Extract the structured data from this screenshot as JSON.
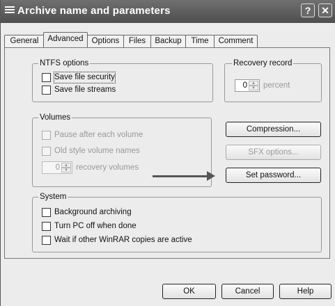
{
  "window": {
    "title": "Archive name and parameters",
    "help_button": "?",
    "close_button": "✕"
  },
  "tabs": [
    {
      "label": "General",
      "active": false
    },
    {
      "label": "Advanced",
      "active": true
    },
    {
      "label": "Options",
      "active": false
    },
    {
      "label": "Files",
      "active": false
    },
    {
      "label": "Backup",
      "active": false
    },
    {
      "label": "Time",
      "active": false
    },
    {
      "label": "Comment",
      "active": false
    }
  ],
  "ntfs": {
    "label": "NTFS options",
    "save_security": {
      "label": "Save file security",
      "checked": false
    },
    "save_streams": {
      "label": "Save file streams",
      "checked": false
    }
  },
  "recovery": {
    "label": "Recovery record",
    "value": "0",
    "unit": "percent"
  },
  "volumes": {
    "label": "Volumes",
    "pause": {
      "label": "Pause after each volume",
      "checked": false,
      "enabled": false
    },
    "old_style": {
      "label": "Old style volume names",
      "checked": false,
      "enabled": false
    },
    "recovery_value": "0",
    "recovery_unit": "recovery volumes"
  },
  "buttons": {
    "compression": "Compression...",
    "sfx_options": "SFX options...",
    "set_password": "Set password...",
    "ok": "OK",
    "cancel": "Cancel",
    "help": "Help"
  },
  "system": {
    "label": "System",
    "background": {
      "label": "Background archiving",
      "checked": false
    },
    "turn_off": {
      "label": "Turn PC off when done",
      "checked": false
    },
    "wait": {
      "label": "Wait if other WinRAR copies are active",
      "checked": false
    }
  }
}
